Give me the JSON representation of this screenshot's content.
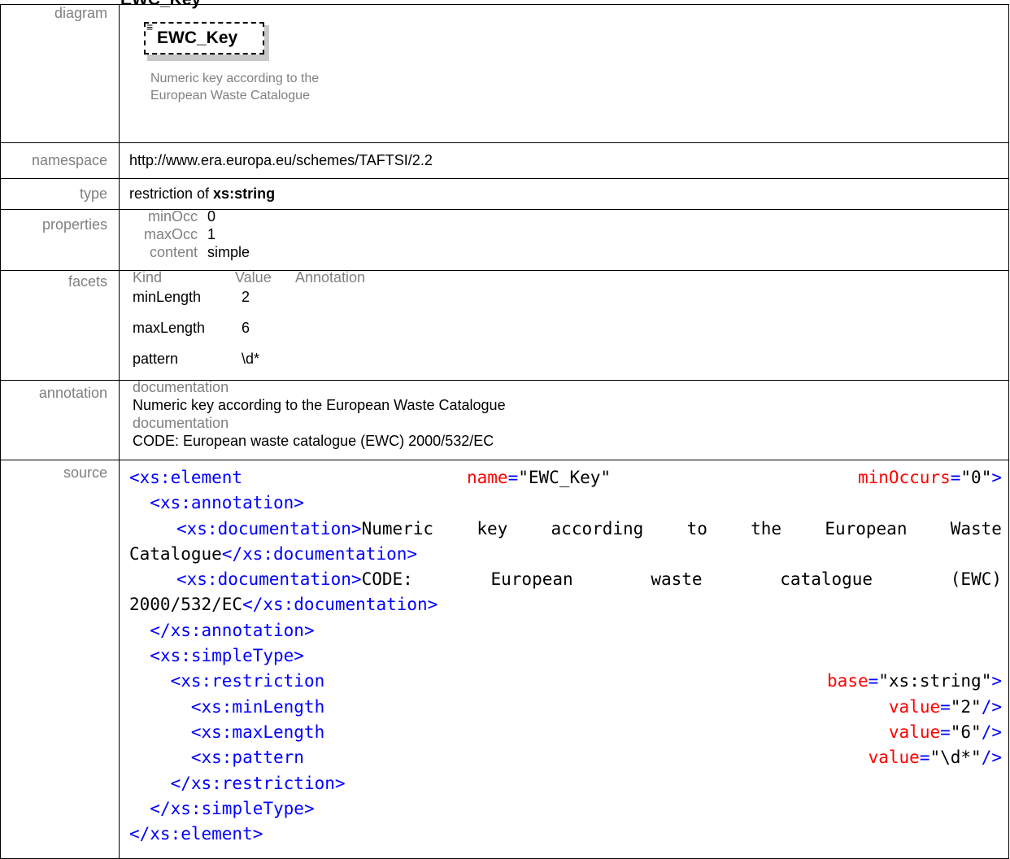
{
  "header_title": "EWC_Key",
  "labels": {
    "diagram": "diagram",
    "namespace": "namespace",
    "type": "type",
    "properties": "properties",
    "facets": "facets",
    "annotation": "annotation",
    "source": "source"
  },
  "diagram": {
    "element_name": "EWC_Key",
    "icon": "≡",
    "description": "Numeric key according to the European Waste Catalogue"
  },
  "namespace": "http://www.era.europa.eu/schemes/TAFTSI/2.2",
  "type": {
    "prefix": "restriction of ",
    "base": "xs:string"
  },
  "properties": [
    {
      "key": "minOcc",
      "value": "0"
    },
    {
      "key": "maxOcc",
      "value": "1"
    },
    {
      "key": "content",
      "value": "simple"
    }
  ],
  "facets": {
    "headers": [
      "Kind",
      "Value",
      "Annotation"
    ],
    "rows": [
      {
        "kind": "minLength",
        "value": "2"
      },
      {
        "kind": "maxLength",
        "value": "6"
      },
      {
        "kind": "pattern",
        "value": "\\d*"
      }
    ]
  },
  "annotation": [
    {
      "label": "documentation",
      "text": "Numeric key according to the European Waste Catalogue"
    },
    {
      "label": "documentation",
      "text": "CODE: European waste catalogue (EWC) 2000/532/EC"
    }
  ],
  "source": {
    "l1_open": "<xs:element",
    "l1_attr1": "name",
    "l1_val1": "\"EWC_Key\"",
    "l1_attr2": "minOccurs",
    "l1_val2": "\"0\"",
    "l2": "<xs:annotation>",
    "l3_open": "<xs:documentation>",
    "l3_words": [
      "Numeric",
      "key",
      "according",
      "to",
      "the",
      "European",
      "Waste"
    ],
    "l4_text": "Catalogue",
    "l4_close": "</xs:documentation>",
    "l5_open": "<xs:documentation>",
    "l5_words": [
      "CODE:",
      "European",
      "waste",
      "catalogue",
      "(EWC)"
    ],
    "l6_text": "2000/532/EC",
    "l6_close": "</xs:documentation>",
    "l7": "</xs:annotation>",
    "l8": "<xs:simpleType>",
    "l9_open": "<xs:restriction",
    "l9_attr": "base",
    "l9_val": "\"xs:string\"",
    "l10_open": "<xs:minLength",
    "l10_attr": "value",
    "l10_val": "\"2\"",
    "l11_open": "<xs:maxLength",
    "l11_attr": "value",
    "l11_val": "\"6\"",
    "l12_open": "<xs:pattern",
    "l12_attr": "value",
    "l12_val": "\"\\d*\"",
    "l13": "</xs:restriction>",
    "l14": "</xs:simpleType>",
    "l15": "</xs:element>"
  }
}
